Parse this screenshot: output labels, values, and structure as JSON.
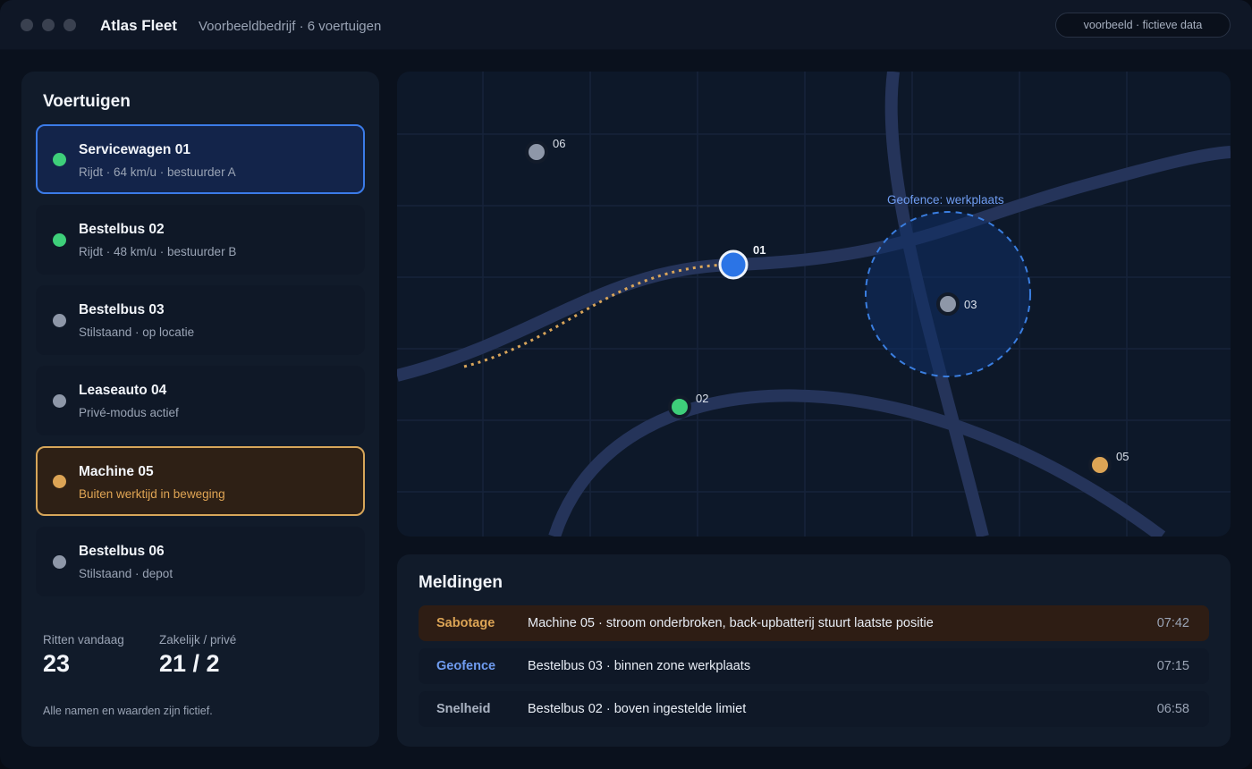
{
  "window": {
    "app_title": "Atlas Fleet",
    "app_subtitle": "Voorbeeldbedrijf · 6 voertuigen",
    "badge": "voorbeeld · fictieve data"
  },
  "colors": {
    "moving": "#3ecf7a",
    "idle": "#8e97a8",
    "warning": "#dca455",
    "selected": "#2b74e6",
    "accent_blue": "#6f9cf0"
  },
  "sidebar": {
    "title": "Voertuigen",
    "vehicles": [
      {
        "name": "Servicewagen 01",
        "status": "Rijdt · 64 km/u · bestuurder A",
        "state": "moving",
        "selected": true
      },
      {
        "name": "Bestelbus 02",
        "status": "Rijdt · 48 km/u · bestuurder B",
        "state": "moving"
      },
      {
        "name": "Bestelbus 03",
        "status": "Stilstaand · op locatie",
        "state": "idle"
      },
      {
        "name": "Leaseauto 04",
        "status": "Privé-modus actief",
        "state": "idle"
      },
      {
        "name": "Machine 05",
        "status": "Buiten werktijd in beweging",
        "state": "warning"
      },
      {
        "name": "Bestelbus 06",
        "status": "Stilstaand · depot",
        "state": "idle"
      }
    ],
    "stats": {
      "trips_label": "Ritten vandaag",
      "trips_value": "23",
      "split_label": "Zakelijk / privé",
      "split_value": "21 / 2"
    },
    "footnote": "Alle namen en waarden zijn fictief."
  },
  "map": {
    "geofence_label": "Geofence: werkplaats",
    "markers": [
      {
        "id": "01",
        "state": "selected"
      },
      {
        "id": "02",
        "state": "moving"
      },
      {
        "id": "03",
        "state": "idle"
      },
      {
        "id": "05",
        "state": "warning"
      },
      {
        "id": "06",
        "state": "idle"
      }
    ]
  },
  "alerts": {
    "title": "Meldingen",
    "items": [
      {
        "type": "Sabotage",
        "message": "Machine 05 · stroom onderbroken, back-upbatterij stuurt laatste positie",
        "time": "07:42",
        "type_color": "#dca455"
      },
      {
        "type": "Geofence",
        "message": "Bestelbus 03 · binnen zone werkplaats",
        "time": "07:15",
        "type_color": "#6f9cf0"
      },
      {
        "type": "Snelheid",
        "message": "Bestelbus 02 · boven ingestelde limiet",
        "time": "06:58",
        "type_color": "#aab3c2"
      }
    ]
  }
}
